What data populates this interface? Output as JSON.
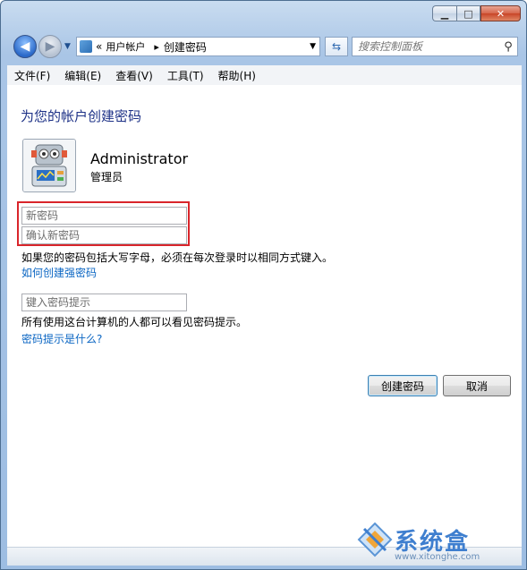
{
  "window": {
    "minimize_glyph": "▁",
    "maximize_glyph": "□",
    "close_glyph": "✕"
  },
  "nav": {
    "back_glyph": "◀",
    "forward_glyph": "▶",
    "breadcrumb_prefix": "«",
    "breadcrumb": [
      "用户帐户",
      "创建密码"
    ],
    "breadcrumb_sep": "▸",
    "search_placeholder": "搜索控制面板"
  },
  "menu": [
    "文件(F)",
    "编辑(E)",
    "查看(V)",
    "工具(T)",
    "帮助(H)"
  ],
  "page": {
    "title": "为您的帐户创建密码",
    "user_name": "Administrator",
    "user_role": "管理员",
    "new_password_placeholder": "新密码",
    "confirm_password_placeholder": "确认新密码",
    "case_note": "如果您的密码包括大写字母，必须在每次登录时以相同方式键入。",
    "strong_password_link": "如何创建强密码",
    "hint_placeholder": "键入密码提示",
    "hint_note": "所有使用这台计算机的人都可以看见密码提示。",
    "hint_link": "密码提示是什么?",
    "create_button": "创建密码",
    "cancel_button": "取消"
  },
  "watermark": {
    "text": "系统盒",
    "url": "www.xitonghe.com"
  },
  "colors": {
    "title": "#1e3287",
    "link": "#0b66c3",
    "highlight_box": "#d9252b"
  }
}
